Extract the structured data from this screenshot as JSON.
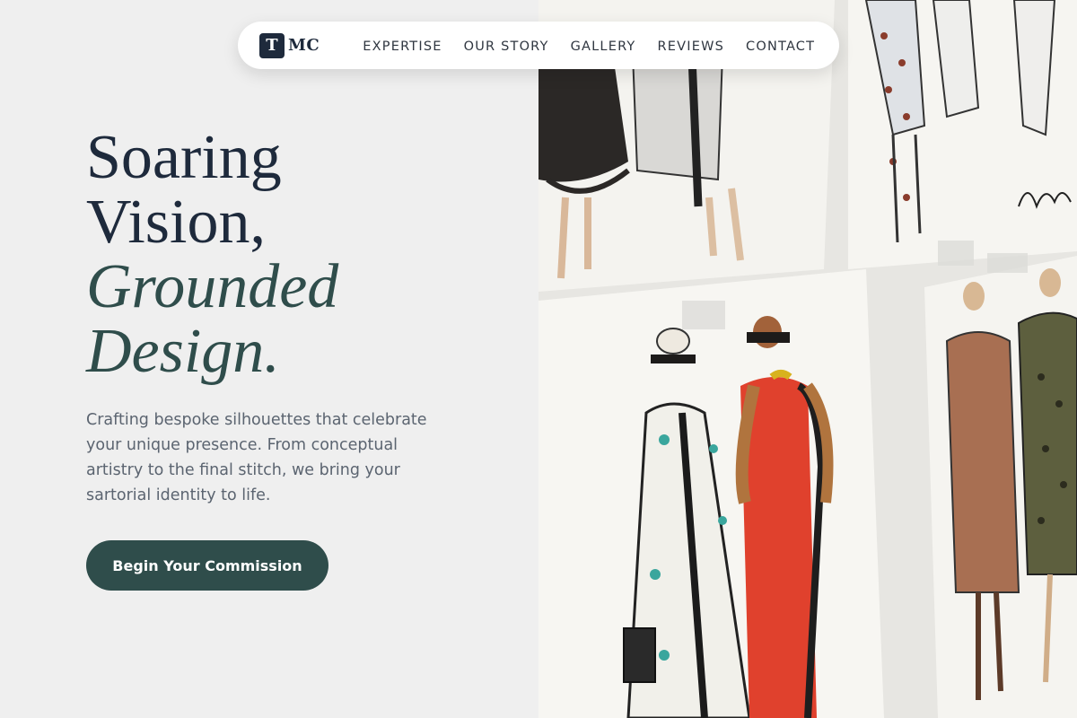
{
  "brand": {
    "mark": "T",
    "name": "MC"
  },
  "nav": {
    "links": [
      "EXPERTISE",
      "OUR STORY",
      "GALLERY",
      "REVIEWS",
      "CONTACT"
    ]
  },
  "hero": {
    "headline": [
      "Soaring",
      "Vision,",
      "Grounded",
      "Design."
    ],
    "lede": "Crafting bespoke silhouettes that celebrate your unique presence. From conceptual artistry to the final stitch, we bring your sartorial identity to life.",
    "cta_label": "Begin Your Commission"
  },
  "colors": {
    "background": "#efefef",
    "navy": "#1e2a3c",
    "accent_green": "#2f4d4b",
    "body_text": "#5b6470"
  }
}
